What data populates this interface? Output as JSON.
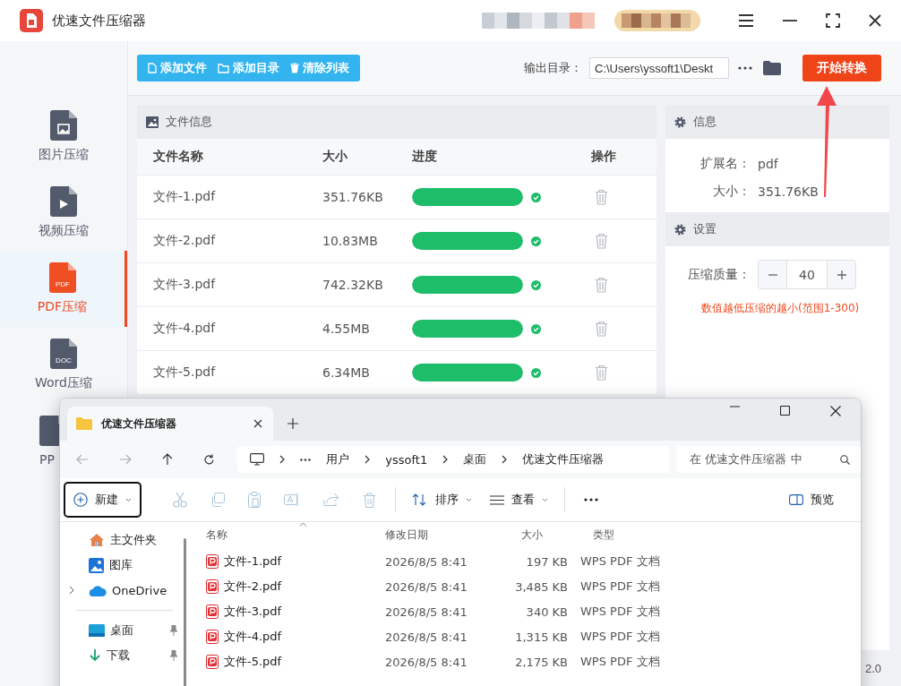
{
  "app": {
    "title": "优速文件压缩器"
  },
  "sidebar": [
    {
      "label": "图片压缩",
      "kind": "image",
      "selected": false
    },
    {
      "label": "视频压缩",
      "kind": "video",
      "selected": false
    },
    {
      "label": "PDF压缩",
      "kind": "doc",
      "icon_text": "PDF",
      "selected": true
    },
    {
      "label": "Word压缩",
      "kind": "doc",
      "icon_text": "DOC",
      "selected": false
    },
    {
      "label": "PP",
      "kind": "doc",
      "selected": false
    }
  ],
  "toolbar": {
    "buttons": [
      {
        "label": "添加文件",
        "kind": "file"
      },
      {
        "label": "添加目录",
        "kind": "folder"
      },
      {
        "label": "清除列表",
        "kind": "trash"
      }
    ],
    "output_label": "输出目录：",
    "output_path": "C:\\Users\\yssoft1\\Deskt",
    "start_button": "开始转换"
  },
  "file_panel": {
    "title": "文件信息",
    "columns": [
      "文件名称",
      "大小",
      "进度",
      "操作"
    ],
    "rows": [
      {
        "name": "文件-1.pdf",
        "size": "351.76KB",
        "level": 1
      },
      {
        "name": "文件-2.pdf",
        "size": "10.83MB",
        "level": 1
      },
      {
        "name": "文件-3.pdf",
        "size": "742.32KB",
        "level": 1
      },
      {
        "name": "文件-4.pdf",
        "size": "4.55MB",
        "level": 1
      },
      {
        "name": "文件-5.pdf",
        "size": "6.34MB",
        "level": 1
      }
    ]
  },
  "info": {
    "title": "信息",
    "fields": [
      {
        "label": "扩展名：",
        "value": "pdf"
      },
      {
        "label": "大小：",
        "value": "351.76KB"
      }
    ]
  },
  "settings": {
    "title": "设置",
    "quality_label": "压缩质量：",
    "quality": "40",
    "hint": "数值越低压缩的越小(范围1-300)"
  },
  "status": {
    "version": "2.0"
  },
  "explorer": {
    "tab_title": "优速文件压缩器",
    "breadcrumb": [
      "用户",
      "yssoft1",
      "桌面",
      "优速文件压缩器"
    ],
    "search_placeholder": "在 优速文件压缩器 中",
    "new_button": "新建",
    "sort_button": "排序",
    "view_button": "查看",
    "preview_button": "预览",
    "nav": [
      {
        "label": "主文件夹",
        "kind": "home"
      },
      {
        "label": "图库",
        "kind": "gallery"
      },
      {
        "label": "OneDrive",
        "kind": "cloud"
      },
      {
        "label": "桌面",
        "kind": "desktop"
      },
      {
        "label": "下载",
        "kind": "download"
      }
    ],
    "columns": [
      "名称",
      "修改日期",
      "大小",
      "类型"
    ],
    "files": [
      {
        "name": "文件-1.pdf",
        "date": "2026/8/5 8:41",
        "size": "197 KB",
        "type": "WPS PDF 文档"
      },
      {
        "name": "文件-2.pdf",
        "date": "2026/8/5 8:41",
        "size": "3,485 KB",
        "type": "WPS PDF 文档"
      },
      {
        "name": "文件-3.pdf",
        "date": "2026/8/5 8:41",
        "size": "340 KB",
        "type": "WPS PDF 文档"
      },
      {
        "name": "文件-4.pdf",
        "date": "2026/8/5 8:41",
        "size": "1,315 KB",
        "type": "WPS PDF 文档"
      },
      {
        "name": "文件-5.pdf",
        "date": "2026/8/5 8:41",
        "size": "2,175 KB",
        "type": "WPS PDF 文档"
      }
    ]
  }
}
